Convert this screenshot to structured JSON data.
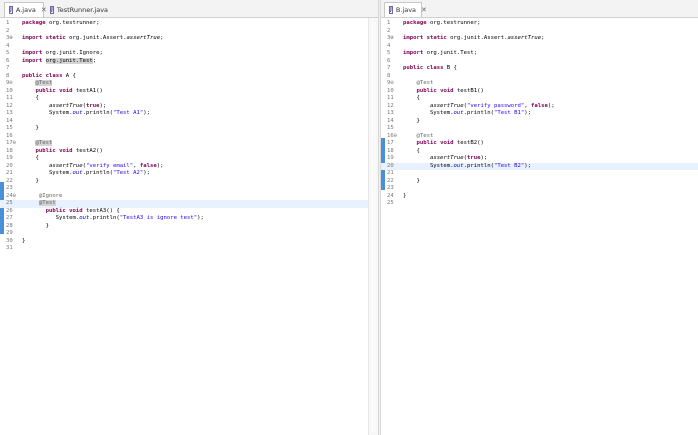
{
  "left_tabs": [
    {
      "label": "A.java",
      "active": true,
      "closable": true
    },
    {
      "label": "TestRunner.java",
      "active": false,
      "closable": false
    }
  ],
  "right_tabs": [
    {
      "label": "B.java",
      "active": true,
      "closable": true
    }
  ],
  "close_glyph": "✕",
  "left_lines": [
    {
      "n": "1",
      "code": "<span class=\"kw\">package</span> org.testrunner;"
    },
    {
      "n": "2",
      "code": ""
    },
    {
      "n": "3⊕",
      "code": "<span class=\"kw\">import</span> <span class=\"kw\">static</span> org.junit.Assert.<span class=\"sfield\">assertTrue</span>;"
    },
    {
      "n": "4",
      "code": ""
    },
    {
      "n": "5",
      "code": "<span class=\"kw\">import</span> org.junit.Ignore;"
    },
    {
      "n": "6",
      "code": "<span class=\"kw\">import</span> <span class=\"hl\">org.junit.Test</span>;"
    },
    {
      "n": "7",
      "code": ""
    },
    {
      "n": "8",
      "code": "<span class=\"kw\">public</span> <span class=\"kw\">class</span> A {"
    },
    {
      "n": "9⊖",
      "code": "    <span class=\"ann hl\">@Test</span>"
    },
    {
      "n": "10",
      "code": "    <span class=\"kw\">public</span> <span class=\"kw\">void</span> testA1()"
    },
    {
      "n": "11",
      "code": "    {"
    },
    {
      "n": "12",
      "code": "        <span class=\"sfield\">assertTrue</span>(<span class=\"kw\">true</span>);"
    },
    {
      "n": "13",
      "code": "        System.<span class=\"fld\">out</span>.println(<span class=\"str\">\"Test A1\"</span>);"
    },
    {
      "n": "14",
      "code": ""
    },
    {
      "n": "15",
      "code": "    }"
    },
    {
      "n": "16",
      "code": ""
    },
    {
      "n": "17⊖",
      "code": "    <span class=\"ann hl\">@Test</span>"
    },
    {
      "n": "18",
      "code": "    <span class=\"kw\">public</span> <span class=\"kw\">void</span> testA2()"
    },
    {
      "n": "19",
      "code": "    {"
    },
    {
      "n": "20",
      "code": "        <span class=\"sfield\">assertTrue</span>(<span class=\"str\">\"verify email\"</span>, <span class=\"kw\">false</span>);"
    },
    {
      "n": "21",
      "code": "        System.<span class=\"fld\">out</span>.println(<span class=\"str\">\"Test A2\"</span>);"
    },
    {
      "n": "22",
      "code": "    }"
    },
    {
      "n": "23",
      "code": ""
    },
    {
      "n": "24⊖",
      "code": "     <span class=\"ann\">@Ignore</span>"
    },
    {
      "n": "25",
      "code": "     <span class=\"ann hl\">@Test</span>",
      "current": true
    },
    {
      "n": "26",
      "code": "       <span class=\"kw\">public</span> <span class=\"kw\">void</span> testA3() {"
    },
    {
      "n": "27",
      "code": "          System.<span class=\"fld\">out</span>.println(<span class=\"str\">\"TestA3 is ignore test\"</span>);"
    },
    {
      "n": "28",
      "code": "       }"
    },
    {
      "n": "29",
      "code": ""
    },
    {
      "n": "30",
      "code": "}"
    },
    {
      "n": "31",
      "code": ""
    }
  ],
  "right_lines": [
    {
      "n": "1",
      "code": "<span class=\"kw\">package</span> org.testrunner;"
    },
    {
      "n": "2",
      "code": ""
    },
    {
      "n": "3⊕",
      "code": "<span class=\"kw\">import</span> <span class=\"kw\">static</span> org.junit.Assert.<span class=\"sfield\">assertTrue</span>;"
    },
    {
      "n": "4",
      "code": ""
    },
    {
      "n": "5",
      "code": "<span class=\"kw\">import</span> org.junit.Test;"
    },
    {
      "n": "6",
      "code": ""
    },
    {
      "n": "7",
      "code": "<span class=\"kw\">public</span> <span class=\"kw\">class</span> B {"
    },
    {
      "n": "8",
      "code": ""
    },
    {
      "n": "9⊖",
      "code": "    <span class=\"ann\">@Test</span>"
    },
    {
      "n": "10",
      "code": "    <span class=\"kw\">public</span> <span class=\"kw\">void</span> testB1()"
    },
    {
      "n": "11",
      "code": "    {"
    },
    {
      "n": "12",
      "code": "        <span class=\"sfield\">assertTrue</span>(<span class=\"str\">\"verify password\"</span>, <span class=\"kw\">false</span>);"
    },
    {
      "n": "13",
      "code": "        System.<span class=\"fld\">out</span>.println(<span class=\"str\">\"Test B1\"</span>);"
    },
    {
      "n": "14",
      "code": "    }"
    },
    {
      "n": "15",
      "code": ""
    },
    {
      "n": "16⊖",
      "code": "    <span class=\"ann\">@Test</span>"
    },
    {
      "n": "17",
      "code": "    <span class=\"kw\">public</span> <span class=\"kw\">void</span> testB2()"
    },
    {
      "n": "18",
      "code": "    {"
    },
    {
      "n": "19",
      "code": "        <span class=\"sfield\">assertTrue</span>(<span class=\"kw\">true</span>);"
    },
    {
      "n": "20",
      "code": "        System.<span class=\"fld\">out</span>.println(<span class=\"str\">\"Test B2\"</span>);",
      "current": true
    },
    {
      "n": "21",
      "code": ""
    },
    {
      "n": "22",
      "code": "    }"
    },
    {
      "n": "23",
      "code": ""
    },
    {
      "n": "24",
      "code": "}"
    },
    {
      "n": "25",
      "code": ""
    }
  ]
}
